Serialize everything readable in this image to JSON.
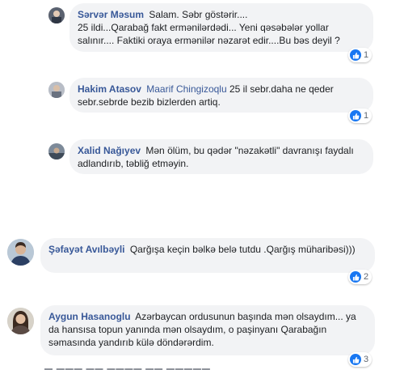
{
  "comments": [
    {
      "author": "Sərvər Məsum",
      "text": "Salam. Səbr göstərir....\n25 ildi...Qarabağ fakt ermənilərdədi... Yeni qəsəbələr yollar salınır.... Faktiki oraya ermənilər nəzarət edir....Bu bəs deyil ?",
      "likes": "1"
    },
    {
      "author": "Hakim Atasov",
      "mention": "Maarif Chingizoqlu",
      "text": "25 il sebr.daha ne qeder sebr.sebrde bezib bizlerden artiq.",
      "likes": "1"
    },
    {
      "author": "Xalid Nağıyev",
      "text": "Mən ölüm, bu qədər \"nəzakətli\" davranışı faydalı adlandırıb, təbliğ etməyin.",
      "likes": ""
    },
    {
      "author": "Şəfayət Avılbəyli",
      "text": "Qarğışa keçin bəlkə belə tutdu .Qarğış müharibəsi)))",
      "likes": "2"
    },
    {
      "author": "Aygun Hasanoglu",
      "text": "Azərbaycan ordusunun başında mən olsaydım... ya da hansısa topun yanında mən olsaydım, o paşinyanı Qarabağın səmasında yandırıb külə döndərərdim.",
      "likes": "3"
    }
  ],
  "colors": {
    "author": "#385898",
    "bubble": "#f2f3f5",
    "like": "#1877f2"
  }
}
